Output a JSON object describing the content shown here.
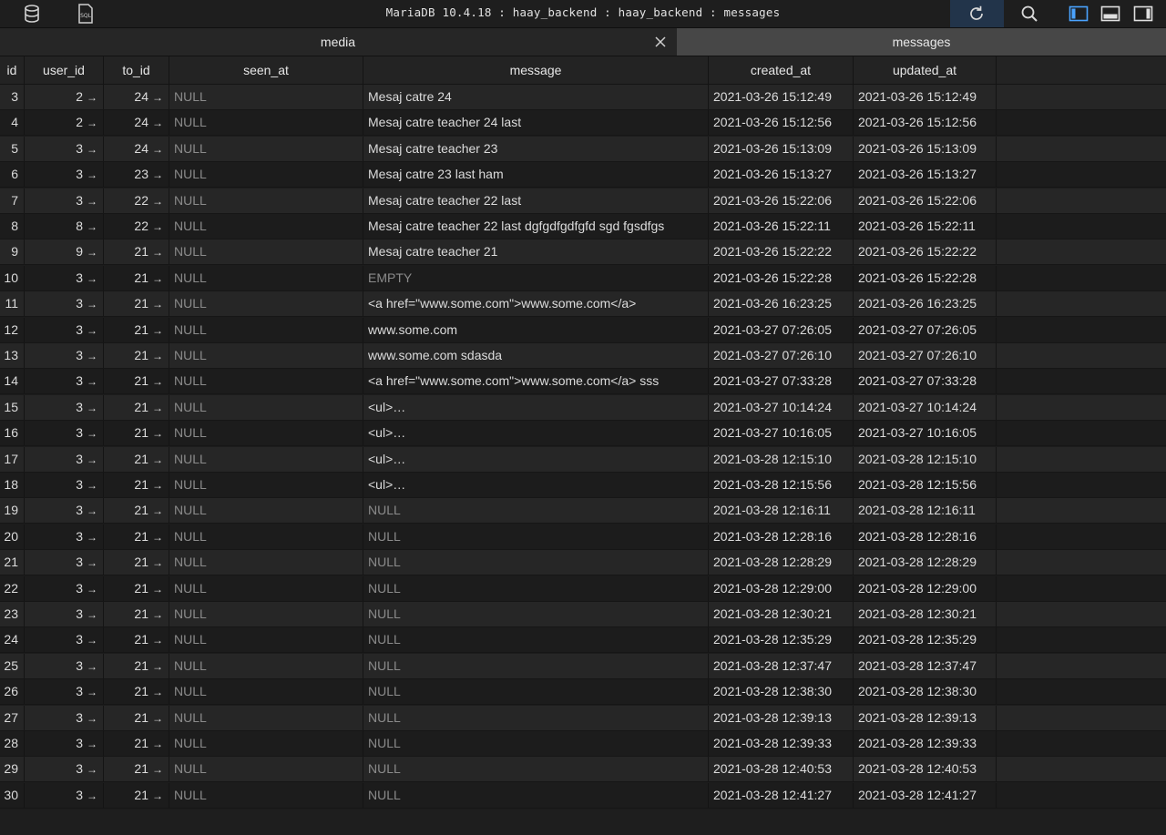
{
  "window": {
    "title": "MariaDB 10.4.18 : haay_backend : haay_backend : messages",
    "icons": [
      "database-icon",
      "sql-icon",
      "refresh-icon",
      "search-icon",
      "left-sidebar-icon",
      "bottom-panel-icon",
      "right-sidebar-icon"
    ]
  },
  "tabs": [
    {
      "label": "media",
      "active": false
    },
    {
      "label": "messages",
      "active": true
    }
  ],
  "table": {
    "columns": [
      "id",
      "user_id",
      "to_id",
      "seen_at",
      "message",
      "created_at",
      "updated_at"
    ],
    "rows": [
      {
        "id": "3",
        "user_id": "2",
        "to_id": "24",
        "seen_at": "NULL",
        "message": "Mesaj catre 24",
        "created_at": "2021-03-26 15:12:49",
        "updated_at": "2021-03-26 15:12:49"
      },
      {
        "id": "4",
        "user_id": "2",
        "to_id": "24",
        "seen_at": "NULL",
        "message": "Mesaj catre teacher 24 last",
        "created_at": "2021-03-26 15:12:56",
        "updated_at": "2021-03-26 15:12:56"
      },
      {
        "id": "5",
        "user_id": "3",
        "to_id": "24",
        "seen_at": "NULL",
        "message": "Mesaj catre teacher 23",
        "created_at": "2021-03-26 15:13:09",
        "updated_at": "2021-03-26 15:13:09"
      },
      {
        "id": "6",
        "user_id": "3",
        "to_id": "23",
        "seen_at": "NULL",
        "message": "Mesaj catre 23 last ham",
        "created_at": "2021-03-26 15:13:27",
        "updated_at": "2021-03-26 15:13:27"
      },
      {
        "id": "7",
        "user_id": "3",
        "to_id": "22",
        "seen_at": "NULL",
        "message": "Mesaj catre teacher 22 last",
        "created_at": "2021-03-26 15:22:06",
        "updated_at": "2021-03-26 15:22:06"
      },
      {
        "id": "8",
        "user_id": "8",
        "to_id": "22",
        "seen_at": "NULL",
        "message": "Mesaj catre teacher 22 last dgfgdfgdfgfd sgd fgsdfgs",
        "created_at": "2021-03-26 15:22:11",
        "updated_at": "2021-03-26 15:22:11"
      },
      {
        "id": "9",
        "user_id": "9",
        "to_id": "21",
        "seen_at": "NULL",
        "message": "Mesaj catre teacher 21",
        "created_at": "2021-03-26 15:22:22",
        "updated_at": "2021-03-26 15:22:22"
      },
      {
        "id": "10",
        "user_id": "3",
        "to_id": "21",
        "seen_at": "NULL",
        "message": "EMPTY",
        "created_at": "2021-03-26 15:22:28",
        "updated_at": "2021-03-26 15:22:28"
      },
      {
        "id": "11",
        "user_id": "3",
        "to_id": "21",
        "seen_at": "NULL",
        "message": "<a href=\"www.some.com\">www.some.com</a>",
        "created_at": "2021-03-26 16:23:25",
        "updated_at": "2021-03-26 16:23:25"
      },
      {
        "id": "12",
        "user_id": "3",
        "to_id": "21",
        "seen_at": "NULL",
        "message": "www.some.com",
        "created_at": "2021-03-27 07:26:05",
        "updated_at": "2021-03-27 07:26:05"
      },
      {
        "id": "13",
        "user_id": "3",
        "to_id": "21",
        "seen_at": "NULL",
        "message": "www.some.com sdasda",
        "created_at": "2021-03-27 07:26:10",
        "updated_at": "2021-03-27 07:26:10"
      },
      {
        "id": "14",
        "user_id": "3",
        "to_id": "21",
        "seen_at": "NULL",
        "message": "<a href=\"www.some.com\">www.some.com</a> sss",
        "created_at": "2021-03-27 07:33:28",
        "updated_at": "2021-03-27 07:33:28"
      },
      {
        "id": "15",
        "user_id": "3",
        "to_id": "21",
        "seen_at": "NULL",
        "message": "<ul>…",
        "created_at": "2021-03-27 10:14:24",
        "updated_at": "2021-03-27 10:14:24"
      },
      {
        "id": "16",
        "user_id": "3",
        "to_id": "21",
        "seen_at": "NULL",
        "message": "<ul>…",
        "created_at": "2021-03-27 10:16:05",
        "updated_at": "2021-03-27 10:16:05"
      },
      {
        "id": "17",
        "user_id": "3",
        "to_id": "21",
        "seen_at": "NULL",
        "message": "<ul>…",
        "created_at": "2021-03-28 12:15:10",
        "updated_at": "2021-03-28 12:15:10"
      },
      {
        "id": "18",
        "user_id": "3",
        "to_id": "21",
        "seen_at": "NULL",
        "message": "<ul>…",
        "created_at": "2021-03-28 12:15:56",
        "updated_at": "2021-03-28 12:15:56"
      },
      {
        "id": "19",
        "user_id": "3",
        "to_id": "21",
        "seen_at": "NULL",
        "message": "NULL",
        "created_at": "2021-03-28 12:16:11",
        "updated_at": "2021-03-28 12:16:11"
      },
      {
        "id": "20",
        "user_id": "3",
        "to_id": "21",
        "seen_at": "NULL",
        "message": "NULL",
        "created_at": "2021-03-28 12:28:16",
        "updated_at": "2021-03-28 12:28:16"
      },
      {
        "id": "21",
        "user_id": "3",
        "to_id": "21",
        "seen_at": "NULL",
        "message": "NULL",
        "created_at": "2021-03-28 12:28:29",
        "updated_at": "2021-03-28 12:28:29"
      },
      {
        "id": "22",
        "user_id": "3",
        "to_id": "21",
        "seen_at": "NULL",
        "message": "NULL",
        "created_at": "2021-03-28 12:29:00",
        "updated_at": "2021-03-28 12:29:00"
      },
      {
        "id": "23",
        "user_id": "3",
        "to_id": "21",
        "seen_at": "NULL",
        "message": "NULL",
        "created_at": "2021-03-28 12:30:21",
        "updated_at": "2021-03-28 12:30:21"
      },
      {
        "id": "24",
        "user_id": "3",
        "to_id": "21",
        "seen_at": "NULL",
        "message": "NULL",
        "created_at": "2021-03-28 12:35:29",
        "updated_at": "2021-03-28 12:35:29"
      },
      {
        "id": "25",
        "user_id": "3",
        "to_id": "21",
        "seen_at": "NULL",
        "message": "NULL",
        "created_at": "2021-03-28 12:37:47",
        "updated_at": "2021-03-28 12:37:47"
      },
      {
        "id": "26",
        "user_id": "3",
        "to_id": "21",
        "seen_at": "NULL",
        "message": "NULL",
        "created_at": "2021-03-28 12:38:30",
        "updated_at": "2021-03-28 12:38:30"
      },
      {
        "id": "27",
        "user_id": "3",
        "to_id": "21",
        "seen_at": "NULL",
        "message": "NULL",
        "created_at": "2021-03-28 12:39:13",
        "updated_at": "2021-03-28 12:39:13"
      },
      {
        "id": "28",
        "user_id": "3",
        "to_id": "21",
        "seen_at": "NULL",
        "message": "NULL",
        "created_at": "2021-03-28 12:39:33",
        "updated_at": "2021-03-28 12:39:33"
      },
      {
        "id": "29",
        "user_id": "3",
        "to_id": "21",
        "seen_at": "NULL",
        "message": "NULL",
        "created_at": "2021-03-28 12:40:53",
        "updated_at": "2021-03-28 12:40:53"
      },
      {
        "id": "30",
        "user_id": "3",
        "to_id": "21",
        "seen_at": "NULL",
        "message": "NULL",
        "created_at": "2021-03-28 12:41:27",
        "updated_at": "2021-03-28 12:41:27"
      }
    ]
  },
  "colors": {
    "background": "#1c1c1c",
    "row_alt": "#262626",
    "active_tab": "#474747",
    "refresh_highlight": "#22344a",
    "null_text": "#8b8b8b",
    "accent_blue": "#4aa3ff"
  },
  "markers": {
    "foreign_key_arrow": "→",
    "null_value": "NULL",
    "empty_value": "EMPTY"
  }
}
